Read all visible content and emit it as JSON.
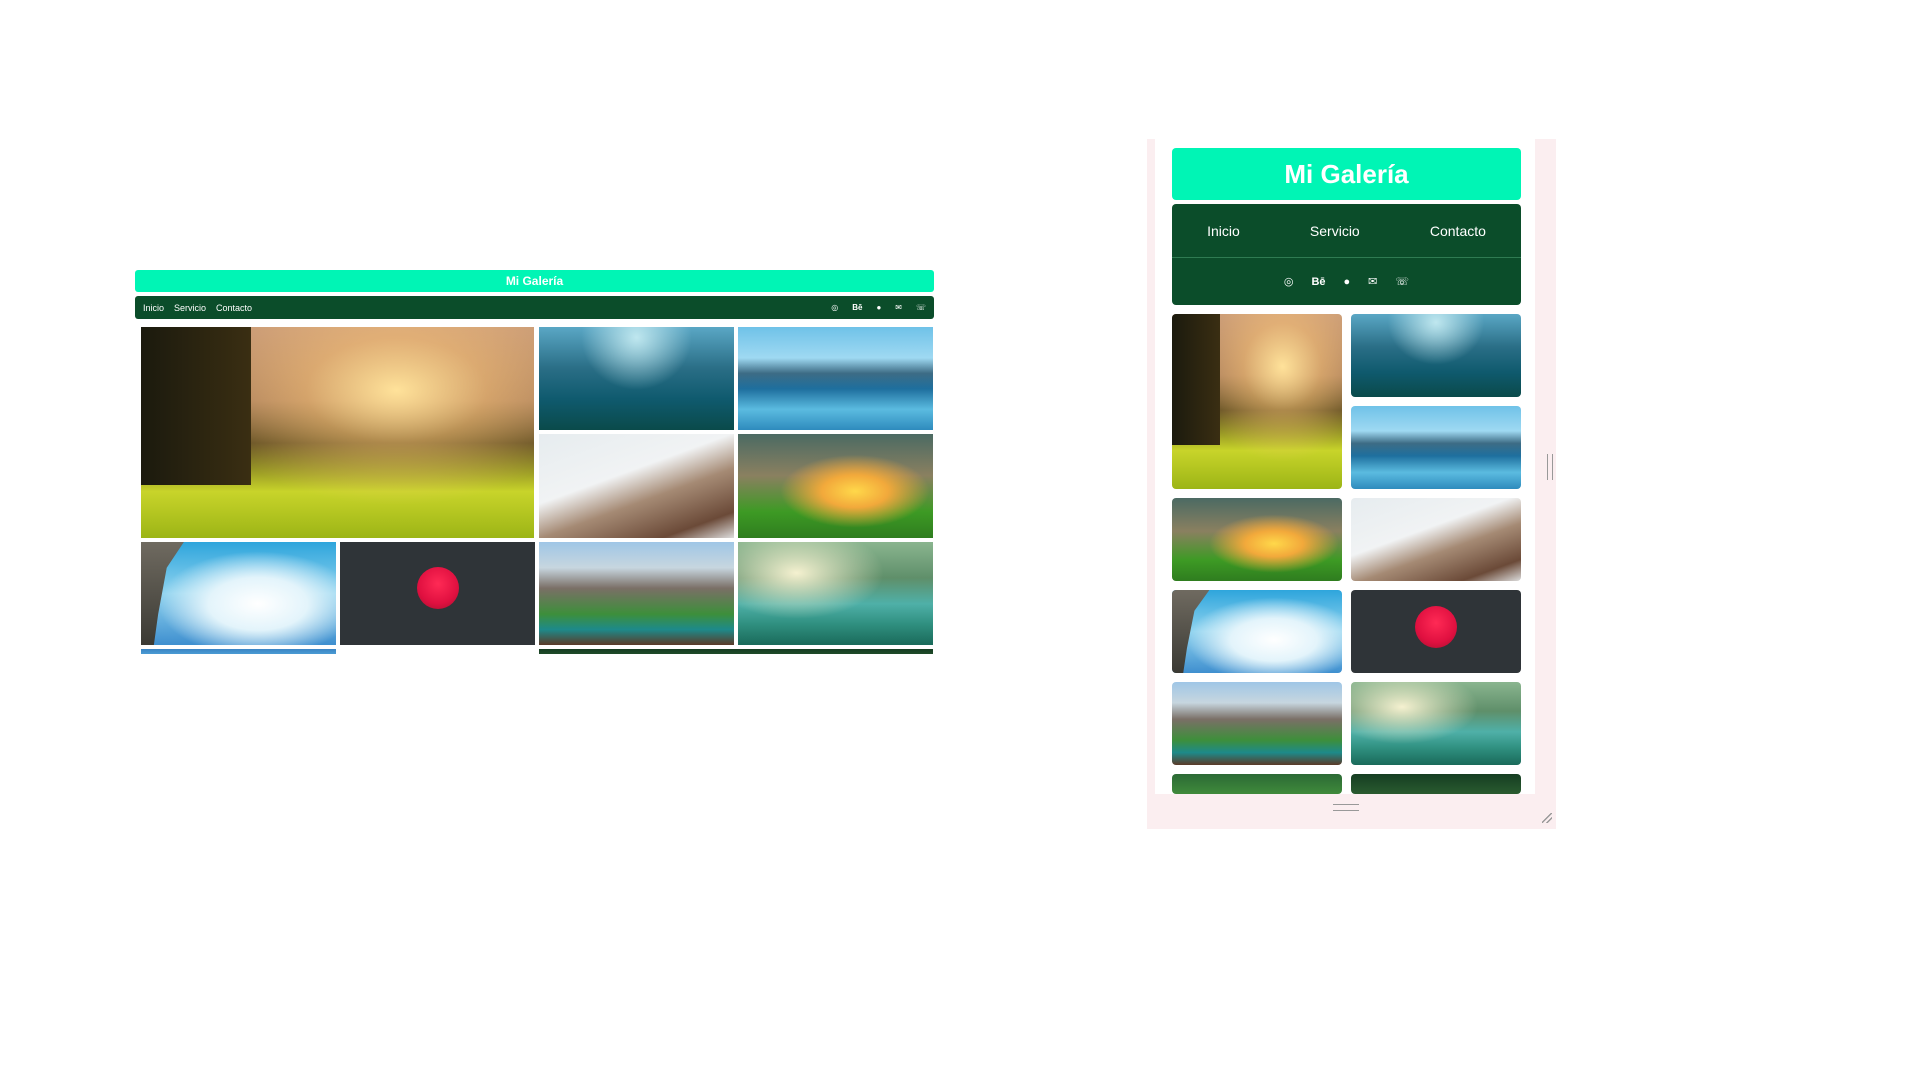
{
  "desktop": {
    "title": "Mi Galería",
    "nav": [
      "Inicio",
      "Servicio",
      "Contacto"
    ],
    "social_icons": [
      {
        "name": "instagram-icon",
        "glyph": "◎"
      },
      {
        "name": "behance-icon",
        "glyph": "Bē"
      },
      {
        "name": "github-icon",
        "glyph": "●"
      },
      {
        "name": "mail-icon",
        "glyph": "✉"
      },
      {
        "name": "whatsapp-icon",
        "glyph": "☏"
      }
    ]
  },
  "mobile": {
    "title": "Mi Galería",
    "nav": [
      "Inicio",
      "Servicio",
      "Contacto"
    ],
    "social_icons": [
      {
        "name": "instagram-icon",
        "glyph": "◎"
      },
      {
        "name": "behance-icon",
        "glyph": "Bē"
      },
      {
        "name": "github-icon",
        "glyph": "●"
      },
      {
        "name": "mail-icon",
        "glyph": "✉"
      },
      {
        "name": "whatsapp-icon",
        "glyph": "☏"
      }
    ]
  },
  "gallery_images": [
    "forest-sunlight",
    "foggy-mountain-lake",
    "mountain-lake-reflection",
    "snowy-village",
    "sunset-hills",
    "cliff-above-clouds",
    "red-sun-dark-sky",
    "alpine-lake-cabin",
    "misty-river-boat"
  ],
  "colors": {
    "title_bg": "#00f5b5",
    "nav_bg": "#0b4d2a",
    "text": "#ffffff",
    "device_frame": "#fbeef0"
  }
}
